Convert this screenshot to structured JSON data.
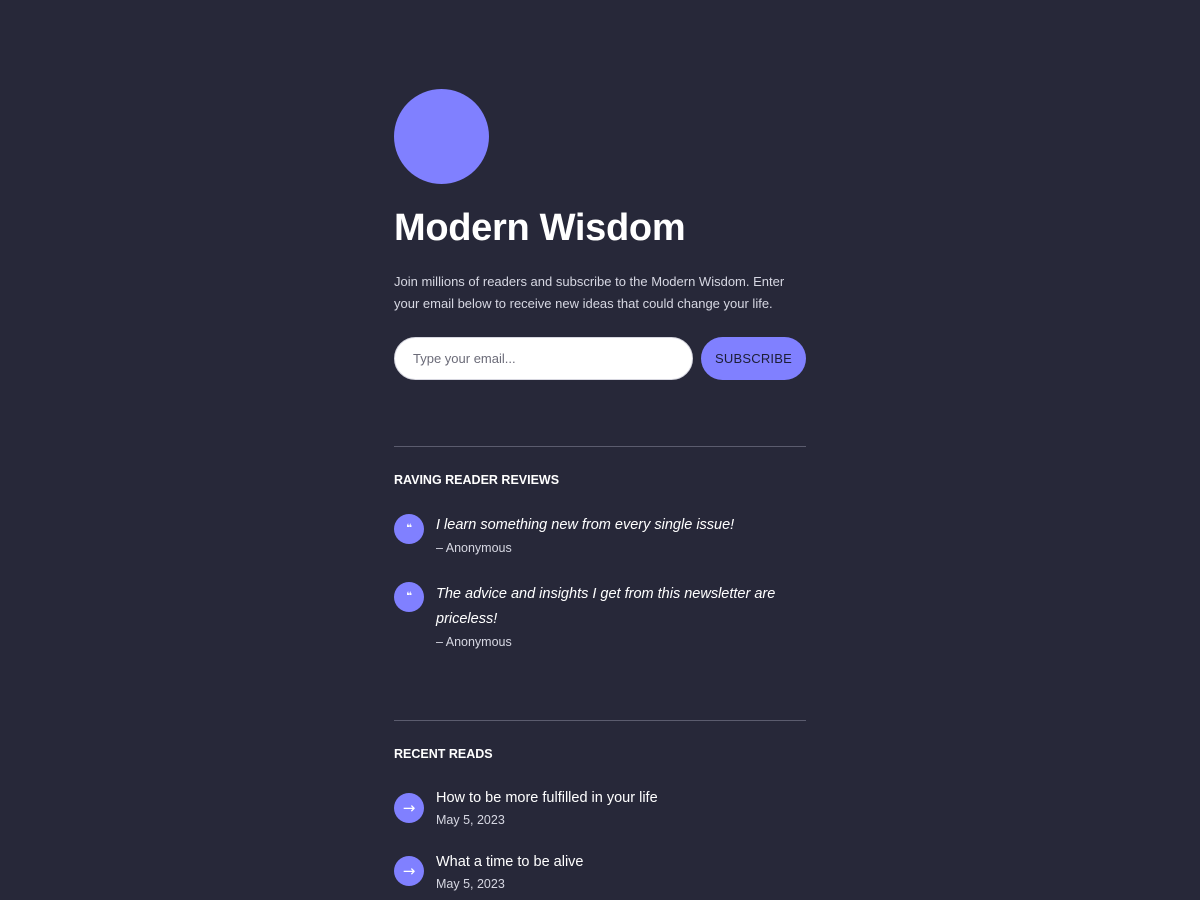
{
  "brand": {
    "title": "Modern Wisdom",
    "logo_color": "#8080ff",
    "intro": "Join millions of readers and subscribe to the Modern Wisdom. Enter your email below to receive new ideas that could change your life."
  },
  "subscribe": {
    "email_placeholder": "Type your email...",
    "email_value": "",
    "button_label": "SUBSCRIBE"
  },
  "reviews": {
    "heading": "RAVING READER REVIEWS",
    "icon": "quote-icon",
    "items": [
      {
        "quote": "I learn something new from every single issue!",
        "author": "– Anonymous"
      },
      {
        "quote": "The advice and insights I get from this newsletter are priceless!",
        "author": "– Anonymous"
      }
    ]
  },
  "recent_reads": {
    "heading": "RECENT READS",
    "icon": "arrow-right-icon",
    "items": [
      {
        "title": "How to be more fulfilled in your life",
        "date": "May 5, 2023"
      },
      {
        "title": "What a time to be alive",
        "date": "May 5, 2023"
      }
    ]
  },
  "colors": {
    "background": "#272839",
    "accent": "#8080ff",
    "divider": "#5b5c6e",
    "muted_text": "#d6d7e2"
  }
}
